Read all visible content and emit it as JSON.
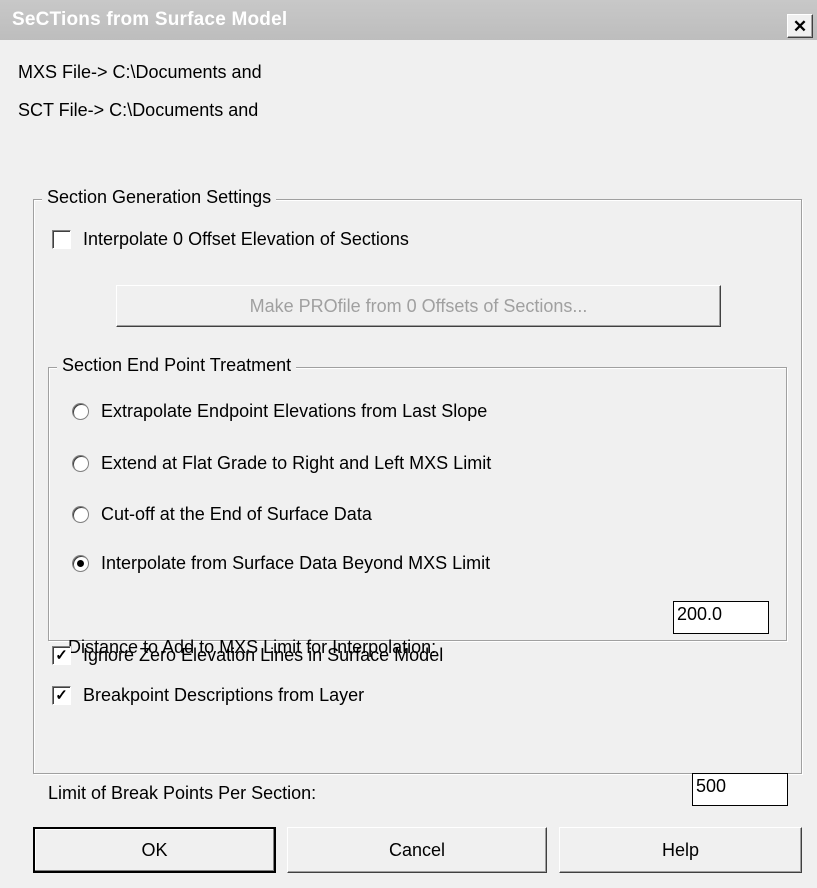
{
  "window": {
    "title": "SeCTions from Surface Model",
    "close_glyph": "✕"
  },
  "info": {
    "mxs_file": "MXS File-> C:\\Documents and",
    "sct_file": "SCT File-> C:\\Documents and"
  },
  "section_generation": {
    "legend": "Section Generation Settings",
    "interpolate_offset": {
      "label": "Interpolate 0 Offset Elevation of Sections",
      "checked": false
    },
    "make_profile_button": "Make PROfile from 0 Offsets of Sections..."
  },
  "end_point_treatment": {
    "legend": "Section End Point Treatment",
    "options": [
      {
        "label": "Extrapolate Endpoint Elevations from Last Slope",
        "selected": false
      },
      {
        "label": "Extend at Flat Grade to Right and Left MXS Limit",
        "selected": false
      },
      {
        "label": "Cut-off at the End of Surface Data",
        "selected": false
      },
      {
        "label": "Interpolate from Surface Data Beyond MXS Limit",
        "selected": true
      }
    ],
    "distance_label": "Distance to Add to MXS Limit for Interpolation:",
    "distance_value": "200.0"
  },
  "options": {
    "ignore_zero": {
      "label": "Ignore Zero Elevation Lines in Surface Model",
      "checked": true
    },
    "breakpoint_desc": {
      "label": "Breakpoint Descriptions from Layer",
      "checked": true
    },
    "check_glyph": "✓"
  },
  "limit": {
    "label": "Limit of Break Points Per Section:",
    "value": "500"
  },
  "buttons": {
    "ok": "OK",
    "cancel": "Cancel",
    "help": "Help"
  }
}
